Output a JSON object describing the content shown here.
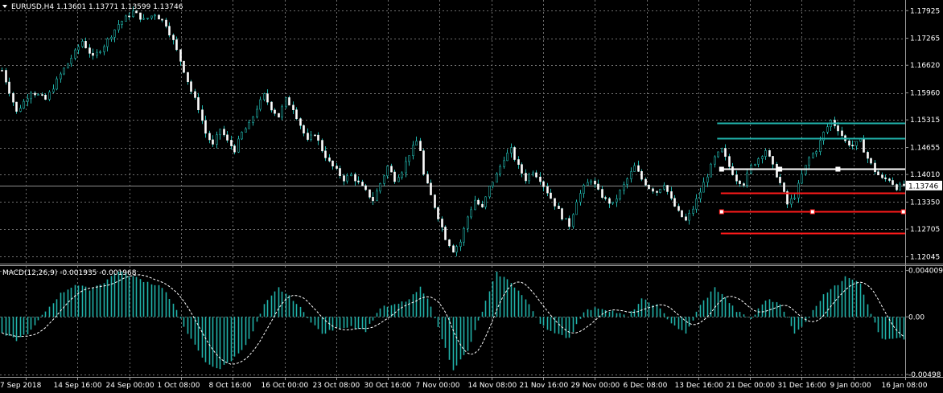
{
  "header": {
    "title": "EURUSD,H4  1.13601 1.13771 1.13599 1.13746"
  },
  "macd_header": {
    "title": "MACD(12,26,9) -0.001935 -0.001968"
  },
  "colors": {
    "background": "#000000",
    "grid": "#6e6e6e",
    "candle": "#20b2aa",
    "macd_hist": "#20b2aa",
    "signal": "#ffffff",
    "cyan_line": "#20b2aa",
    "white_line": "#ffffff",
    "red_line": "#ff1a1a",
    "price_tag_bg": "#ffffff",
    "price_tag_text": "#000000"
  },
  "chart_data": [
    {
      "type": "candlestick",
      "title": "EURUSD,H4",
      "ohlc_last": {
        "open": 1.13601,
        "high": 1.13771,
        "low": 1.13599,
        "close": 1.13746
      },
      "ylim": [
        1.119,
        1.1818
      ],
      "y_ticks": [
        "1.17925",
        "1.17265",
        "1.16620",
        "1.15960",
        "1.15315",
        "1.14655",
        "1.14010",
        "1.13350",
        "1.12705",
        "1.12045"
      ],
      "x_ticks": [
        "7 Sep 2018",
        "14 Sep 16:00",
        "24 Sep 00:00",
        "1 Oct 08:00",
        "8 Oct 16:00",
        "16 Oct 00:00",
        "23 Oct 08:00",
        "30 Oct 16:00",
        "7 Nov 00:00",
        "14 Nov 08:00",
        "21 Nov 16:00",
        "29 Nov 00:00",
        "6 Dec 08:00",
        "13 Dec 16:00",
        "21 Dec 00:00",
        "31 Dec 16:00",
        "9 Jan 00:00",
        "16 Jan 08:00"
      ],
      "current_price_label": "1.13746",
      "current_price": 1.13746,
      "close_path": [
        [
          0,
          1.165
        ],
        [
          4,
          1.155
        ],
        [
          8,
          1.16
        ],
        [
          12,
          1.158
        ],
        [
          16,
          1.164
        ],
        [
          19,
          1.168
        ],
        [
          22,
          1.172
        ],
        [
          25,
          1.168
        ],
        [
          28,
          1.171
        ],
        [
          32,
          1.176
        ],
        [
          36,
          1.179
        ],
        [
          39,
          1.177
        ],
        [
          42,
          1.1785
        ],
        [
          45,
          1.176
        ],
        [
          47,
          1.172
        ],
        [
          50,
          1.165
        ],
        [
          52,
          1.16
        ],
        [
          54,
          1.156
        ],
        [
          56,
          1.15
        ],
        [
          58,
          1.147
        ],
        [
          60,
          1.151
        ],
        [
          62,
          1.148
        ],
        [
          64,
          1.146
        ],
        [
          66,
          1.15
        ],
        [
          68,
          1.152
        ],
        [
          70,
          1.156
        ],
        [
          72,
          1.159
        ],
        [
          74,
          1.156
        ],
        [
          76,
          1.154
        ],
        [
          78,
          1.158
        ],
        [
          80,
          1.156
        ],
        [
          82,
          1.152
        ],
        [
          84,
          1.148
        ],
        [
          86,
          1.15
        ],
        [
          88,
          1.146
        ],
        [
          90,
          1.143
        ],
        [
          92,
          1.141
        ],
        [
          94,
          1.139
        ],
        [
          96,
          1.14
        ],
        [
          98,
          1.138
        ],
        [
          100,
          1.136
        ],
        [
          102,
          1.134
        ],
        [
          104,
          1.138
        ],
        [
          106,
          1.142
        ],
        [
          108,
          1.139
        ],
        [
          110,
          1.141
        ],
        [
          112,
          1.145
        ],
        [
          114,
          1.148
        ],
        [
          115,
          1.146
        ],
        [
          116,
          1.14
        ],
        [
          118,
          1.135
        ],
        [
          120,
          1.13
        ],
        [
          122,
          1.125
        ],
        [
          124,
          1.122
        ],
        [
          126,
          1.124
        ],
        [
          128,
          1.13
        ],
        [
          130,
          1.134
        ],
        [
          132,
          1.132
        ],
        [
          134,
          1.137
        ],
        [
          136,
          1.14
        ],
        [
          138,
          1.144
        ],
        [
          140,
          1.146
        ],
        [
          142,
          1.142
        ],
        [
          144,
          1.139
        ],
        [
          146,
          1.141
        ],
        [
          148,
          1.139
        ],
        [
          150,
          1.136
        ],
        [
          152,
          1.133
        ],
        [
          154,
          1.13
        ],
        [
          156,
          1.128
        ],
        [
          158,
          1.134
        ],
        [
          160,
          1.137
        ],
        [
          162,
          1.139
        ],
        [
          164,
          1.136
        ],
        [
          166,
          1.134
        ],
        [
          168,
          1.133
        ],
        [
          170,
          1.136
        ],
        [
          172,
          1.139
        ],
        [
          174,
          1.142
        ],
        [
          176,
          1.139
        ],
        [
          178,
          1.137
        ],
        [
          180,
          1.136
        ],
        [
          182,
          1.138
        ],
        [
          184,
          1.134
        ],
        [
          186,
          1.131
        ],
        [
          188,
          1.129
        ],
        [
          190,
          1.132
        ],
        [
          192,
          1.136
        ],
        [
          194,
          1.14
        ],
        [
          196,
          1.144
        ],
        [
          198,
          1.146
        ],
        [
          200,
          1.142
        ],
        [
          202,
          1.139
        ],
        [
          204,
          1.138
        ],
        [
          206,
          1.142
        ],
        [
          208,
          1.144
        ],
        [
          210,
          1.146
        ],
        [
          212,
          1.142
        ],
        [
          214,
          1.138
        ],
        [
          216,
          1.133
        ],
        [
          218,
          1.135
        ],
        [
          220,
          1.14
        ],
        [
          222,
          1.144
        ],
        [
          224,
          1.146
        ],
        [
          226,
          1.15
        ],
        [
          228,
          1.153
        ],
        [
          230,
          1.151
        ],
        [
          232,
          1.148
        ],
        [
          234,
          1.147
        ],
        [
          236,
          1.148
        ],
        [
          238,
          1.144
        ],
        [
          240,
          1.141
        ],
        [
          242,
          1.139
        ],
        [
          244,
          1.139
        ],
        [
          246,
          1.137
        ],
        [
          248,
          1.1375
        ]
      ],
      "horizontal_lines": [
        {
          "price": 1.1525,
          "color": "cyan",
          "x_start_bar": 197
        },
        {
          "price": 1.1488,
          "color": "cyan",
          "x_start_bar": 197
        },
        {
          "price": 1.1414,
          "color": "white",
          "x_start_bar": 198,
          "markers_bar": [
            198,
            214,
            230
          ]
        },
        {
          "price": 1.1357,
          "color": "red",
          "x_start_bar": 198
        },
        {
          "price": 1.1312,
          "color": "red",
          "x_start_bar": 198,
          "markers_bar": [
            198,
            223,
            248
          ]
        },
        {
          "price": 1.1262,
          "color": "red",
          "x_start_bar": 198
        }
      ]
    },
    {
      "type": "bar",
      "title": "MACD(12,26,9)",
      "main": -0.001935,
      "signal": -0.001968,
      "ylim": [
        -0.0052,
        0.0044
      ],
      "y_ticks": [
        "0.004009",
        "0.00",
        "-0.00498"
      ],
      "macd_path": [
        [
          0,
          -0.0015
        ],
        [
          4,
          -0.002
        ],
        [
          8,
          -0.0012
        ],
        [
          12,
          0.0005
        ],
        [
          16,
          0.002
        ],
        [
          20,
          0.0028
        ],
        [
          24,
          0.0024
        ],
        [
          28,
          0.003
        ],
        [
          32,
          0.004
        ],
        [
          36,
          0.0035
        ],
        [
          40,
          0.003
        ],
        [
          44,
          0.0026
        ],
        [
          48,
          0.0005
        ],
        [
          52,
          -0.002
        ],
        [
          56,
          -0.004
        ],
        [
          60,
          -0.0045
        ],
        [
          64,
          -0.0035
        ],
        [
          68,
          -0.002
        ],
        [
          72,
          0.001
        ],
        [
          76,
          0.0025
        ],
        [
          80,
          0.0015
        ],
        [
          84,
          0.0
        ],
        [
          88,
          -0.0015
        ],
        [
          92,
          -0.001
        ],
        [
          96,
          -0.0008
        ],
        [
          100,
          -0.0012
        ],
        [
          104,
          0.0008
        ],
        [
          108,
          0.001
        ],
        [
          112,
          0.0015
        ],
        [
          115,
          0.0025
        ],
        [
          118,
          0.001
        ],
        [
          120,
          -0.001
        ],
        [
          124,
          -0.0045
        ],
        [
          128,
          -0.003
        ],
        [
          132,
          0.0005
        ],
        [
          136,
          0.0038
        ],
        [
          140,
          0.003
        ],
        [
          144,
          0.0015
        ],
        [
          148,
          -0.0005
        ],
        [
          152,
          -0.0015
        ],
        [
          156,
          -0.0018
        ],
        [
          160,
          0.0005
        ],
        [
          164,
          0.0008
        ],
        [
          168,
          0.0005
        ],
        [
          172,
          0.0
        ],
        [
          176,
          0.0015
        ],
        [
          180,
          0.001
        ],
        [
          184,
          -0.0005
        ],
        [
          188,
          -0.0015
        ],
        [
          192,
          0.001
        ],
        [
          196,
          0.0025
        ],
        [
          198,
          0.002
        ],
        [
          202,
          0.0005
        ],
        [
          206,
          -0.0002
        ],
        [
          210,
          0.0015
        ],
        [
          214,
          0.0012
        ],
        [
          218,
          -0.0015
        ],
        [
          222,
          0.0
        ],
        [
          226,
          0.002
        ],
        [
          230,
          0.0028
        ],
        [
          232,
          0.0036
        ],
        [
          236,
          0.003
        ],
        [
          238,
          0.001
        ],
        [
          242,
          -0.002
        ],
        [
          248,
          -0.0019
        ]
      ]
    }
  ]
}
